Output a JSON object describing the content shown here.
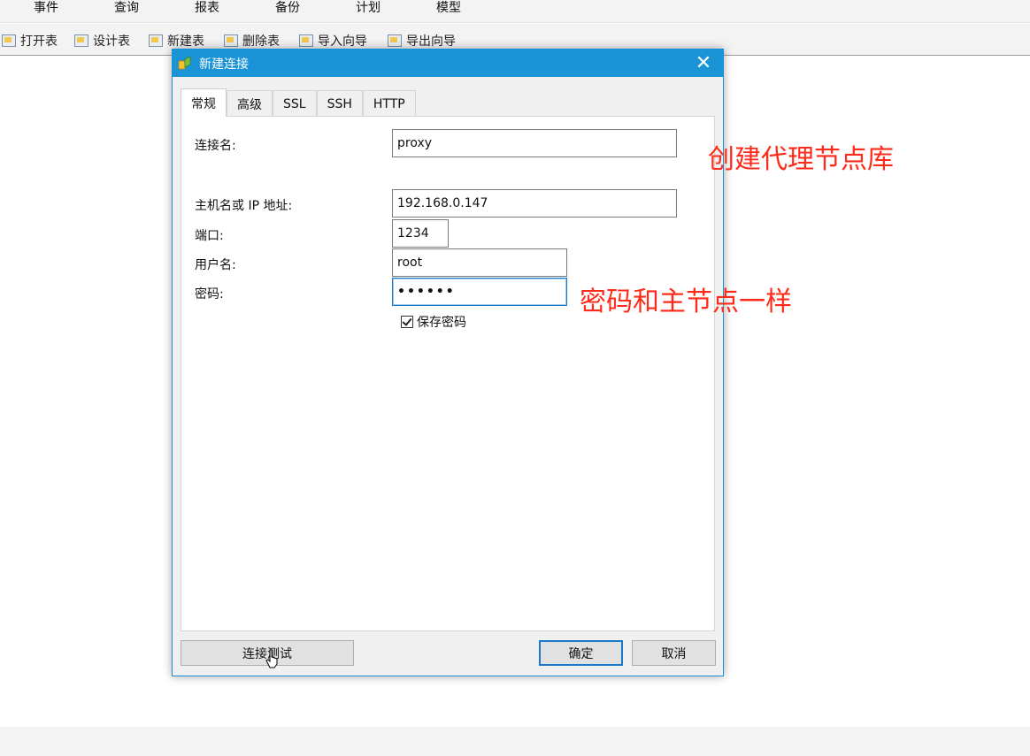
{
  "menubar": {
    "items": [
      "事件",
      "查询",
      "报表",
      "备份",
      "计划",
      "模型"
    ]
  },
  "toolbar": {
    "items": [
      {
        "label": "打开表",
        "icon": "open-table-icon"
      },
      {
        "label": "设计表",
        "icon": "design-table-icon"
      },
      {
        "label": "新建表",
        "icon": "new-table-icon"
      },
      {
        "label": "删除表",
        "icon": "delete-table-icon"
      },
      {
        "label": "导入向导",
        "icon": "import-wizard-icon"
      },
      {
        "label": "导出向导",
        "icon": "export-wizard-icon"
      }
    ]
  },
  "dialog": {
    "title": "新建连接",
    "close_glyph": "✕",
    "tabs": [
      {
        "label": "常规",
        "active": true
      },
      {
        "label": "高级",
        "active": false
      },
      {
        "label": "SSL",
        "active": false
      },
      {
        "label": "SSH",
        "active": false
      },
      {
        "label": "HTTP",
        "active": false
      }
    ],
    "form": {
      "connection_name": {
        "label": "连接名:",
        "value": "proxy"
      },
      "host": {
        "label": "主机名或 IP 地址:",
        "value": "192.168.0.147"
      },
      "port": {
        "label": "端口:",
        "value": "1234"
      },
      "username": {
        "label": "用户名:",
        "value": "root"
      },
      "password": {
        "label": "密码:",
        "value": "••••••"
      },
      "save_password": {
        "label": "保存密码",
        "checked": true
      }
    },
    "buttons": {
      "test": "连接测试",
      "ok": "确定",
      "cancel": "取消"
    }
  },
  "annotations": {
    "connection_note": "创建代理节点库",
    "password_note": "密码和主节点一样"
  },
  "colors": {
    "titlebar": "#1a94d6",
    "annotation": "#ff2a1a",
    "focus": "#1b79c8"
  }
}
